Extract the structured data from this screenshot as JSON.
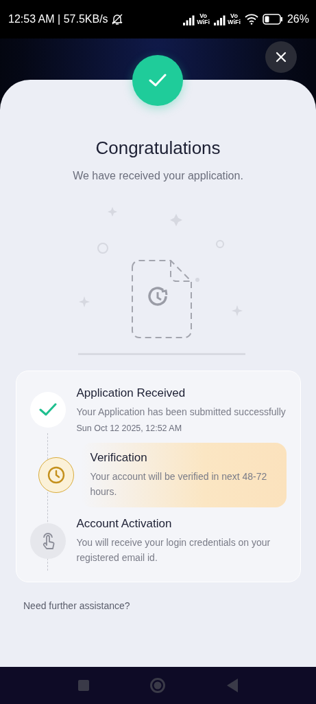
{
  "status_bar": {
    "time": "12:53 AM | 57.5KB/s",
    "battery": "26%",
    "network_labels": [
      [
        "Vo",
        "WiFi"
      ],
      [
        "Vo",
        "WiFi"
      ]
    ]
  },
  "header": {
    "title": "Congratulations",
    "subtitle": "We have received your application."
  },
  "steps": [
    {
      "kind": "done",
      "title": "Application Received",
      "description": "Your Application has been submitted successfully",
      "timestamp": "Sun Oct 12 2025, 12:52 AM"
    },
    {
      "kind": "current",
      "title": "Verification",
      "description": "Your account will be verified in next 48-72 hours."
    },
    {
      "kind": "pending",
      "title": "Account Activation",
      "description": "You will receive your login credentials on your registered email id."
    }
  ],
  "footer": {
    "help_text": "Need further assistance?"
  }
}
